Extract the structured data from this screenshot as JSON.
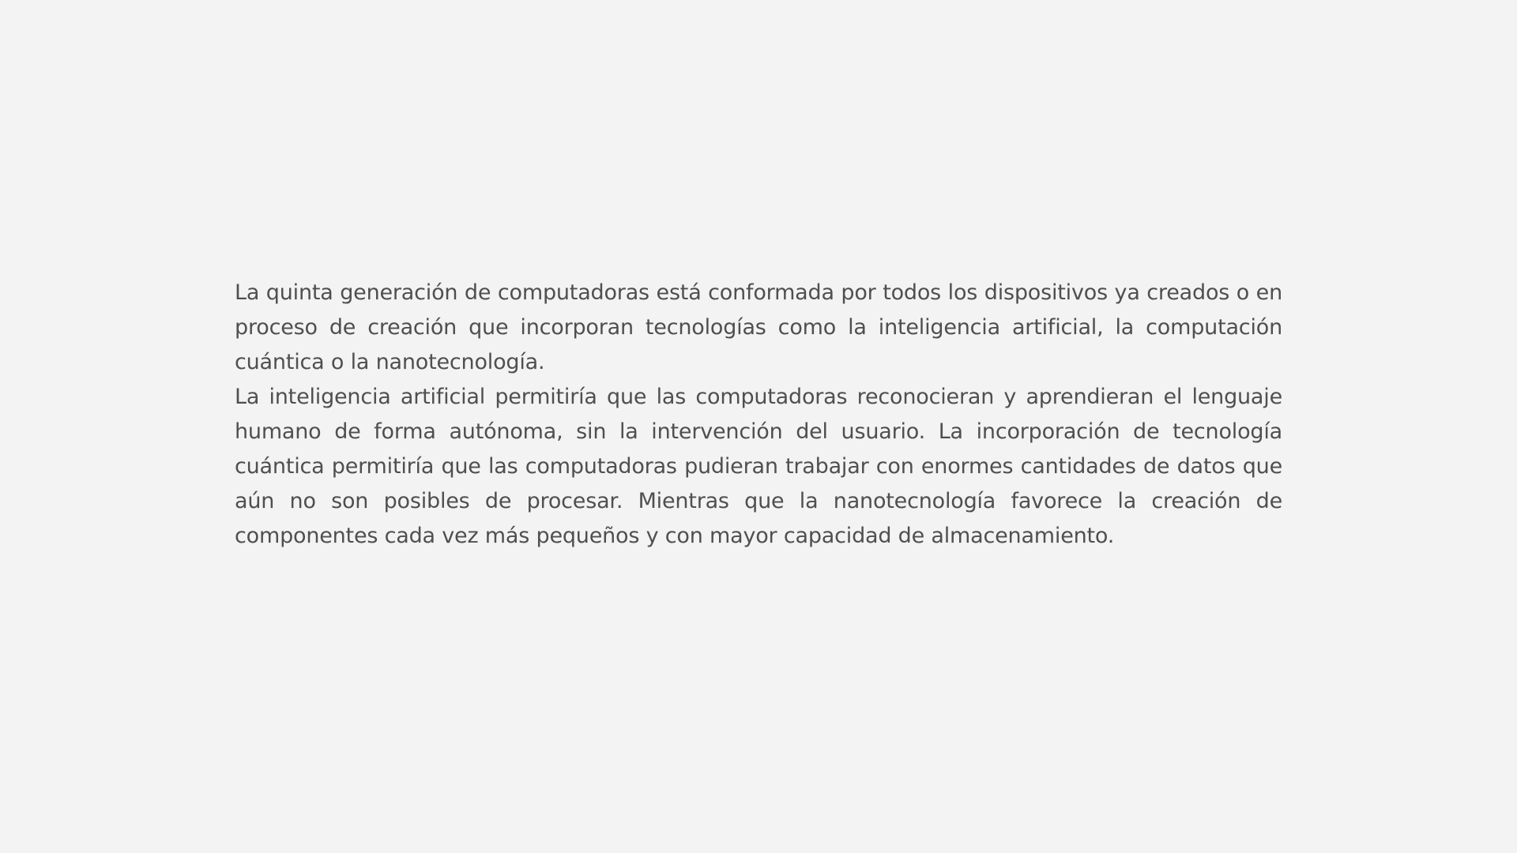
{
  "content": {
    "paragraphs": [
      "La quinta generación de computadoras está conformada por todos los dispositivos ya creados o en proceso de creación que incorporan tecnologías como la inteligencia artificial, la computación cuántica o la nanotecnología.",
      "La inteligencia artificial permitiría que las computadoras reconocieran y aprendieran el lenguaje humano de forma autónoma, sin la intervención del usuario. La incorporación de tecnología cuántica permitiría que las computadoras pudieran trabajar con enormes cantidades de datos que aún no son posibles de procesar. Mientras que la nanotecnología favorece la creación de componentes cada vez más pequeños y con mayor capacidad de almacenamiento."
    ]
  },
  "colors": {
    "background": "#f3f3f3",
    "text": "#4f4f4f"
  }
}
